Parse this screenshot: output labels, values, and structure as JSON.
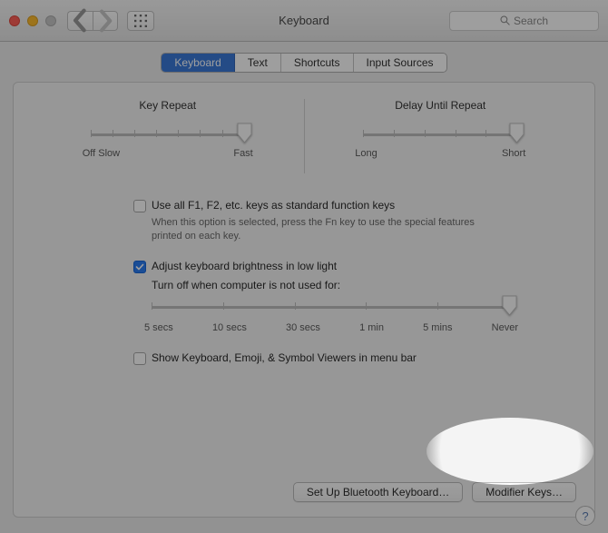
{
  "window": {
    "title": "Keyboard",
    "search_placeholder": "Search"
  },
  "tabs": [
    "Keyboard",
    "Text",
    "Shortcuts",
    "Input Sources"
  ],
  "active_tab": 0,
  "sliders": {
    "key_repeat": {
      "label": "Key Repeat",
      "min_label": "Off Slow",
      "max_label": "Fast",
      "ticks": 8,
      "value_pct": 100
    },
    "delay": {
      "label": "Delay Until Repeat",
      "min_label": "Long",
      "max_label": "Short",
      "ticks": 6,
      "value_pct": 100
    }
  },
  "options": {
    "fn_keys": {
      "checked": false,
      "label": "Use all F1, F2, etc. keys as standard function keys",
      "hint": "When this option is selected, press the Fn key to use the special features printed on each key."
    },
    "auto_brightness": {
      "checked": true,
      "label": "Adjust keyboard brightness in low light"
    },
    "turnoff": {
      "label": "Turn off when computer is not used for:",
      "ticks_labels": [
        "5 secs",
        "10 secs",
        "30 secs",
        "1 min",
        "5 mins",
        "Never"
      ],
      "value_pct": 100
    },
    "show_viewers": {
      "checked": false,
      "label": "Show Keyboard, Emoji, & Symbol Viewers in menu bar"
    }
  },
  "buttons": {
    "bluetooth": "Set Up Bluetooth Keyboard…",
    "modifier": "Modifier Keys…"
  },
  "help": "?"
}
